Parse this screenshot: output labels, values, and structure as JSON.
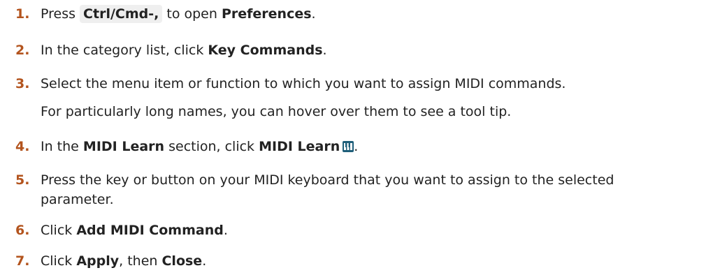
{
  "steps": [
    {
      "num": "1.",
      "a": "Press ",
      "key": "Ctrl/Cmd-,",
      "b": " to open ",
      "bold": "Preferences",
      "c": "."
    },
    {
      "num": "2.",
      "a": "In the category list, click ",
      "bold": "Key Commands",
      "c": "."
    },
    {
      "num": "3.",
      "line1": "Select the menu item or function to which you want to assign MIDI commands.",
      "line2": "For particularly long names, you can hover over them to see a tool tip."
    },
    {
      "num": "4.",
      "a": "In the ",
      "bold1": "MIDI Learn",
      "b": " section, click ",
      "bold2": "MIDI Learn",
      "c": ".",
      "icon": "midi-learn-icon"
    },
    {
      "num": "5.",
      "line1": "Press the key or button on your MIDI keyboard that you want to assign to the selected",
      "line2": "parameter."
    },
    {
      "num": "6.",
      "a": "Click ",
      "bold": "Add MIDI Command",
      "c": "."
    },
    {
      "num": "7.",
      "a": "Click ",
      "bold1": "Apply",
      "b": ", then ",
      "bold2": "Close",
      "c": "."
    }
  ],
  "colors": {
    "number": "#b3541e",
    "text": "#222222",
    "key_bg": "#efefef",
    "icon_bg": "#1f5f7a"
  }
}
